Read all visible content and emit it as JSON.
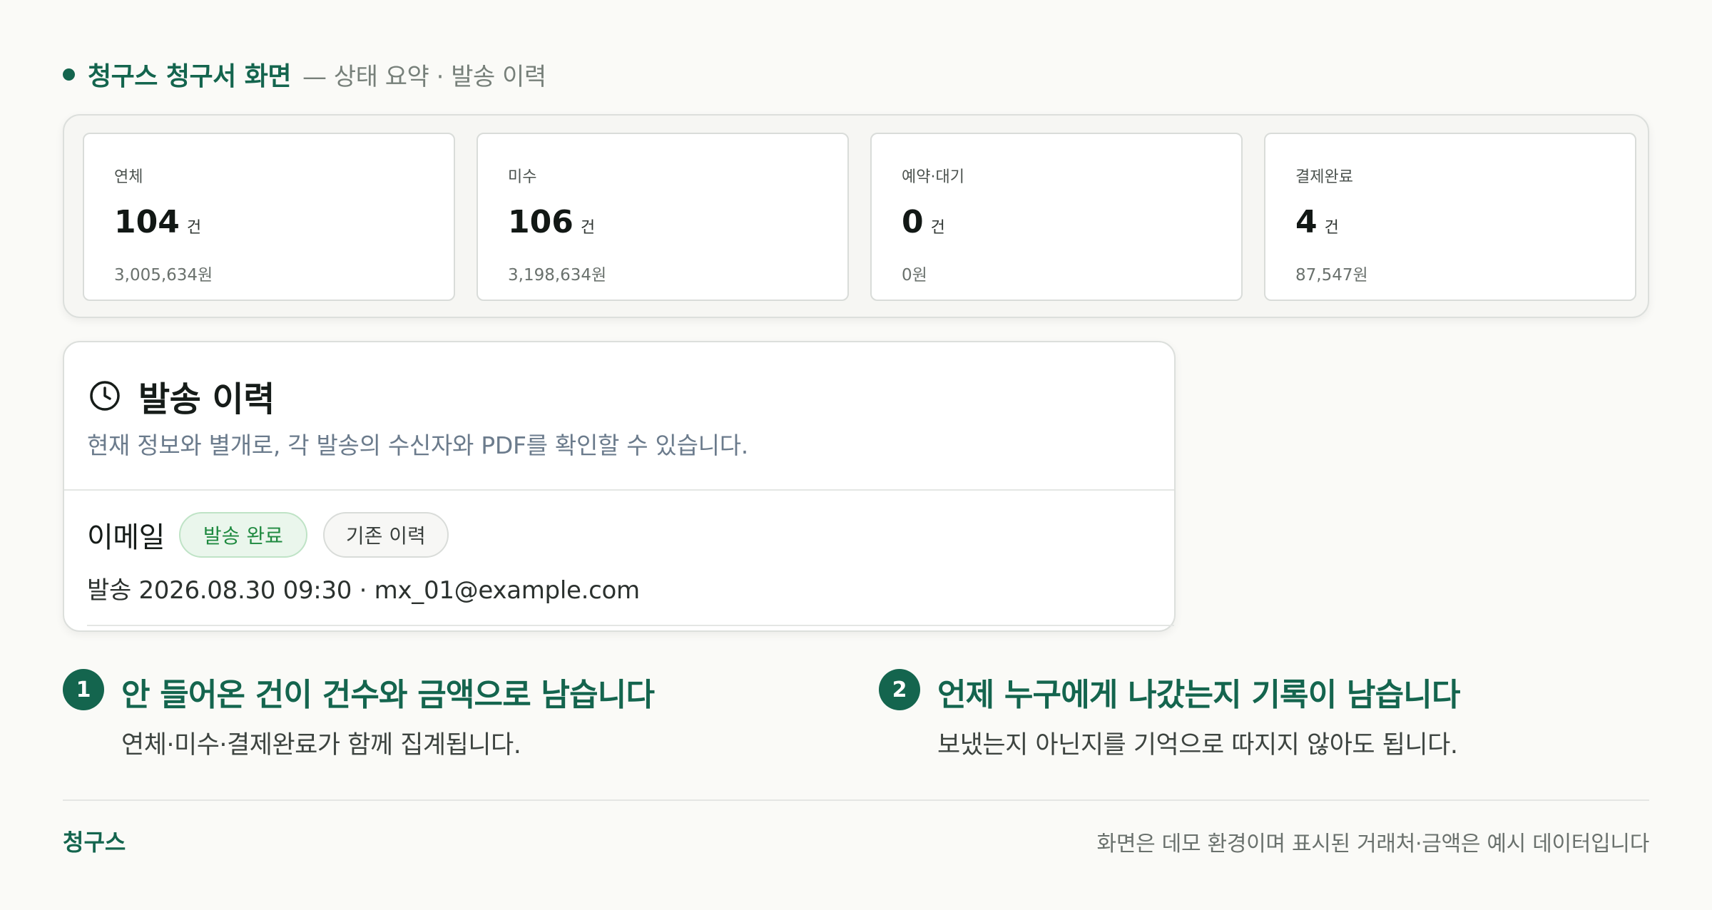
{
  "header": {
    "brand": "청구스 청구서 화면",
    "subtitle": "— 상태 요약 · 발송 이력"
  },
  "stats": [
    {
      "label": "연체",
      "count": "104",
      "unit": "건",
      "amount": "3,005,634원"
    },
    {
      "label": "미수",
      "count": "106",
      "unit": "건",
      "amount": "3,198,634원"
    },
    {
      "label": "예약·대기",
      "count": "0",
      "unit": "건",
      "amount": "0원"
    },
    {
      "label": "결제완료",
      "count": "4",
      "unit": "건",
      "amount": "87,547원"
    }
  ],
  "history": {
    "title": "발송 이력",
    "description": "현재 정보와 별개로, 각 발송의 수신자와 PDF를 확인할 수 있습니다.",
    "entry": {
      "channel": "이메일",
      "status_badge": "발송 완료",
      "tag": "기존 이력",
      "meta": "발송 2026.08.30 09:30 · mx_01@example.com"
    }
  },
  "features": [
    {
      "number": "1",
      "title": "안 들어온 건이 건수와 금액으로 남습니다",
      "description": "연체·미수·결제완료가 함께 집계됩니다."
    },
    {
      "number": "2",
      "title": "언제 누구에게 나갔는지 기록이 남습니다",
      "description": "보냈는지 아닌지를 기억으로 따지지 않아도 됩니다."
    }
  ],
  "footer": {
    "brand": "청구스",
    "note": "화면은 데모 환경이며 표시된 거래처·금액은 예시 데이터입니다"
  },
  "colors": {
    "brand": "#14654e",
    "success": "#1f8a40",
    "background": "#fafaf7"
  },
  "icons": {
    "history": "clock-icon"
  }
}
